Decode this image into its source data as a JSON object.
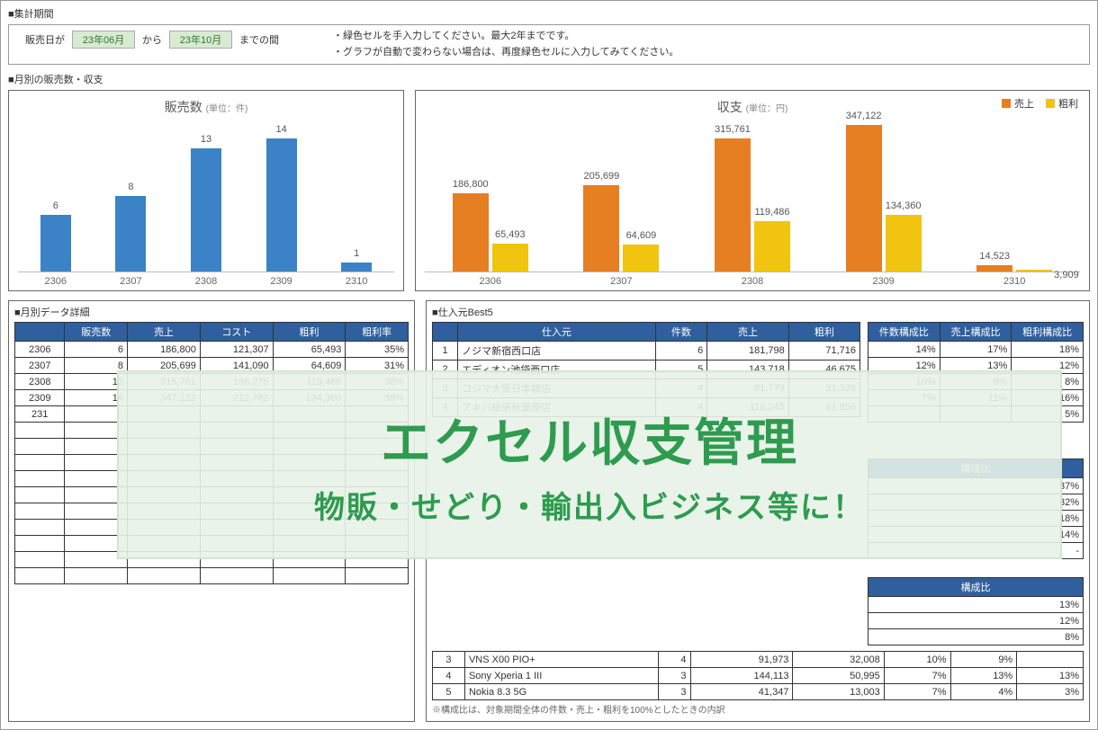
{
  "period": {
    "section_label": "■集計期間",
    "label_prefix": "販売日が",
    "from": "23年06月",
    "from_to_text": "から",
    "to": "23年10月",
    "to_suffix": "までの間",
    "notes": [
      "・緑色セルを手入力してください。最大2年までです。",
      "・グラフが自動で変わらない場合は、再度緑色セルに入力してみてください。"
    ]
  },
  "charts_section_label": "■月別の販売数・収支",
  "chart_data": [
    {
      "type": "bar",
      "title": "販売数",
      "subtitle": "(単位：件)",
      "categories": [
        "2306",
        "2307",
        "2308",
        "2309",
        "2310"
      ],
      "values": [
        6,
        8,
        13,
        14,
        1
      ],
      "ylim": [
        0,
        16
      ],
      "color": "#3b82c6"
    },
    {
      "type": "bar",
      "title": "収支",
      "subtitle": "(単位：円)",
      "categories": [
        "2306",
        "2307",
        "2308",
        "2309",
        "2310"
      ],
      "series": [
        {
          "name": "売上",
          "color": "#e67e22",
          "values": [
            186800,
            205699,
            315761,
            347122,
            14523
          ]
        },
        {
          "name": "粗利",
          "color": "#f1c40f",
          "values": [
            65493,
            64609,
            119486,
            134360,
            3909
          ]
        }
      ],
      "ylim": [
        0,
        360000
      ]
    }
  ],
  "monthly_table": {
    "section_label": "■月別データ詳細",
    "headers": [
      "",
      "販売数",
      "売上",
      "コスト",
      "粗利",
      "粗利率"
    ],
    "rows": [
      [
        "2306",
        6,
        "186,800",
        "121,307",
        "65,493",
        "35%"
      ],
      [
        "2307",
        8,
        "205,699",
        "141,090",
        "64,609",
        "31%"
      ],
      [
        "2308",
        13,
        "315,761",
        "196,275",
        "119,486",
        "38%"
      ],
      [
        "2309",
        14,
        "347,122",
        "212,762",
        "134,360",
        "39%"
      ],
      [
        "231",
        "",
        "",
        "",
        "",
        ""
      ]
    ],
    "empty_rows": 10
  },
  "best5": {
    "section_label": "■仕入元Best5",
    "headers": [
      "",
      "仕入元",
      "件数",
      "売上",
      "粗利"
    ],
    "rows": [
      [
        "1",
        "ノジマ新宿西口店",
        6,
        "181,798",
        "71,716"
      ],
      [
        "2",
        "エディオン池袋西口店",
        5,
        "143,718",
        "46,675"
      ],
      [
        "3",
        "コジマ大阪日本橋店",
        4,
        "81,779",
        "31,326"
      ],
      [
        "4",
        "アキバ総研秋葉原店",
        4,
        "118,245",
        "61,956"
      ]
    ],
    "ratio_headers": [
      "件数構成比",
      "売上構成比",
      "粗利構成比"
    ],
    "ratio_rows": [
      [
        "14%",
        "17%",
        "18%"
      ],
      [
        "12%",
        "13%",
        "12%"
      ],
      [
        "10%",
        "8%",
        "8%"
      ],
      [
        "7%",
        "11%",
        "16%"
      ],
      [
        "",
        "",
        "5%"
      ]
    ],
    "ratio_block2_header": "構成比",
    "ratio_block2": [
      "37%",
      "32%",
      "18%",
      "14%",
      "-"
    ],
    "ratio_block3_header": "構成比",
    "ratio_block3": [
      "13%",
      "12%",
      "8%"
    ]
  },
  "product_rows": [
    [
      "3",
      "VNS X00 PIO+",
      4,
      "91,973",
      "32,008",
      "10%",
      "9%",
      ""
    ],
    [
      "4",
      "Sony Xperia 1 III",
      3,
      "144,113",
      "50,995",
      "7%",
      "13%",
      "13%"
    ],
    [
      "5",
      "Nokia 8.3 5G",
      3,
      "41,347",
      "13,003",
      "7%",
      "4%",
      "3%"
    ]
  ],
  "footnote": "※構成比は、対象期間全体の件数・売上・粗利を100%としたときの内訳",
  "overlay": {
    "title": "エクセル収支管理",
    "subtitle": "物販・せどり・輸出入ビジネス等に！"
  }
}
